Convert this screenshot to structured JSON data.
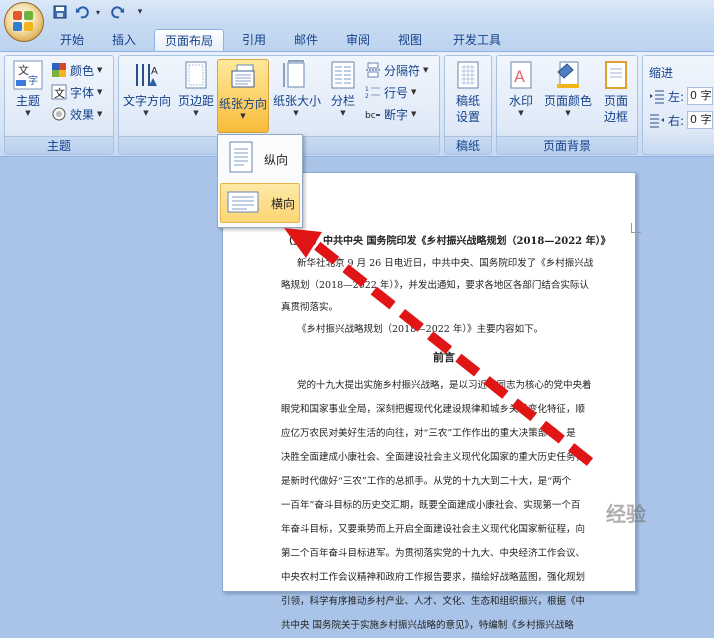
{
  "quick_access": [
    "save-icon",
    "undo-icon",
    "redo-icon",
    "customize-icon"
  ],
  "tabs": [
    "开始",
    "插入",
    "页面布局",
    "引用",
    "邮件",
    "审阅",
    "视图",
    "开发工具"
  ],
  "active_tab": "页面布局",
  "ribbon": {
    "themes": {
      "theme": "主题",
      "colors": "颜色",
      "fonts": "字体",
      "effects": "效果",
      "group": "主题"
    },
    "page_setup": {
      "text_direction": "文字方向",
      "margins": "页边距",
      "orientation": "纸张方向",
      "size": "纸张大小",
      "columns": "分栏",
      "breaks": "分隔符",
      "line_numbers": "行号",
      "hyphenation": "断字"
    },
    "draft": {
      "label_line1": "稿纸",
      "label_line2": "设置",
      "group": "稿纸"
    },
    "page_background": {
      "watermark": "水印",
      "page_color": "页面颜色",
      "borders_line1": "页面",
      "borders_line2": "边框",
      "group": "页面背景"
    },
    "paragraph": {
      "indent": "缩进",
      "left": "左:",
      "right": "右:",
      "left_value": "0 字",
      "right_value": "0 字"
    }
  },
  "orientation_menu": {
    "portrait": "纵向",
    "landscape": "横向",
    "selected": "横向"
  },
  "document": {
    "title": "（全文）中共中央 国务院印发《乡村振兴战略规划（2018—2022 年）》",
    "p1_line1": "新华社北京 9 月 26 日电近日，中共中央、国务院印发了《乡村振兴战",
    "p1_line2": "略规划（2018—2022 年）》，并发出通知，要求各地区各部门结合实际认",
    "p1_line3": "真贯彻落实。",
    "p2": "《乡村振兴战略规划（2018—2022 年）》主要内容如下。",
    "heading": "前言",
    "body": [
      "党的十九大提出实施乡村振兴战略，是以习近平同志为核心的党中央着",
      "眼党和国家事业全局，深刻把握现代化建设规律和城乡关系变化特征，顺",
      "应亿万农民对美好生活的向往，对“三农”工作作出的重大决策部署，是",
      "决胜全面建成小康社会、全面建设社会主义现代化国家的重大历史任务，",
      "是新时代做好“三农”工作的总抓手。从党的十九大到二十大，是“两个",
      "一百年”奋斗目标的历史交汇期，既要全面建成小康社会、实现第一个百",
      "年奋斗目标，又要乘势而上开启全面建设社会主义现代化国家新征程，向",
      "第二个百年奋斗目标进军。为贯彻落实党的十九大、中央经济工作会议、",
      "中央农村工作会议精神和政府工作报告要求，描绘好战略蓝图，强化规划",
      "引领，科学有序推动乡村产业、人才、文化、生态和组织振兴，根据《中",
      "共中央 国务院关于实施乡村振兴战略的意见》，特编制《乡村振兴战略"
    ]
  },
  "watermark_text": "经验",
  "colors": {
    "arrow": "#e01515",
    "highlight": "#fbd574",
    "ribbon": "#dbe6f6"
  }
}
